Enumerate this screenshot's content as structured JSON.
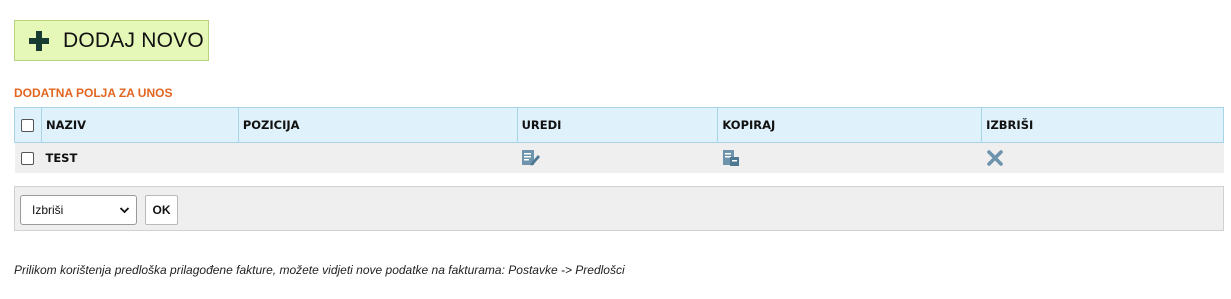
{
  "toolbar": {
    "add_label": "DODAJ NOVO"
  },
  "section": {
    "title": "DODATNA POLJA ZA UNOS"
  },
  "table": {
    "columns": [
      "NAZIV",
      "POZICIJA",
      "UREDI",
      "KOPIRAJ",
      "IZBRIŠI"
    ],
    "rows": [
      {
        "naziv": "TEST",
        "pozicija": "",
        "edit_icon": "edit-icon",
        "copy_icon": "copy-icon",
        "delete_icon": "delete-icon"
      }
    ]
  },
  "bulk": {
    "selected_action": "Izbriši",
    "ok_label": "OK"
  },
  "footnote": "Prilikom korištenja predloška prilagođene fakture, možete vidjeti nove podatke na fakturama: Postavke -> Predlošci",
  "colors": {
    "accent": "#e2661f",
    "header_bg": "#dff1fa",
    "add_button_bg": "#e6f8b8",
    "icon": "#6e94ad"
  }
}
